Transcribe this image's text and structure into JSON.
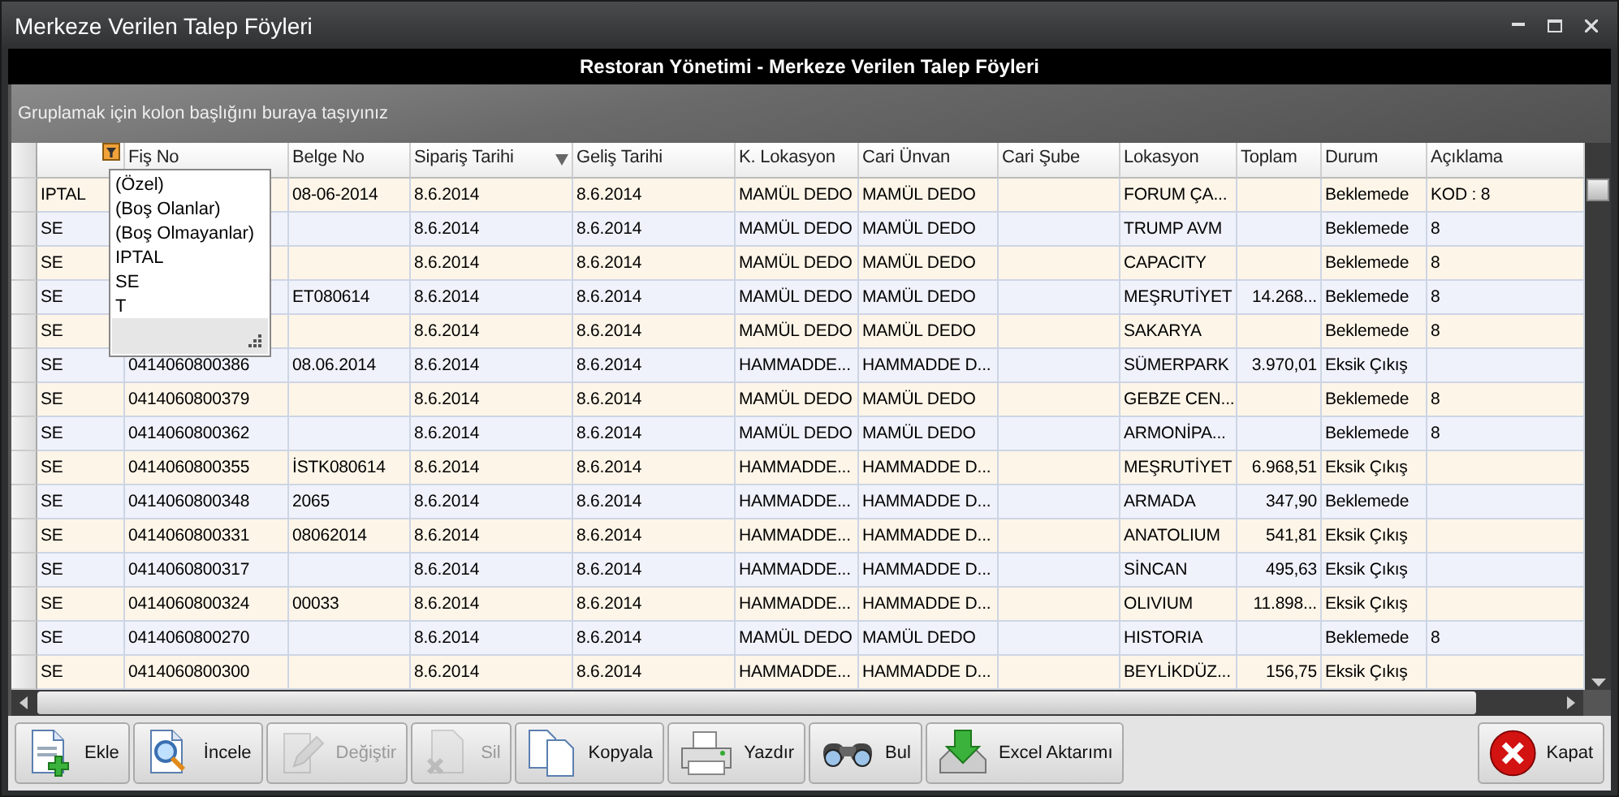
{
  "window": {
    "title": "Merkeze Verilen Talep Föyleri"
  },
  "header": {
    "title": "Restoran Yönetimi - Merkeze Verilen Talep Föyleri"
  },
  "group_panel": {
    "hint": "Gruplamak için kolon başlığını buraya taşıyınız"
  },
  "table": {
    "columns": [
      {
        "filter": true
      },
      {
        "label": "Fiş No"
      },
      {
        "label": "Belge No"
      },
      {
        "label": "Sipariş Tarihi",
        "sorted_descending": true
      },
      {
        "label": "Geliş Tarihi"
      },
      {
        "label": "K. Lokasyon"
      },
      {
        "label": "Cari Ünvan"
      },
      {
        "label": "Cari Şube"
      },
      {
        "label": "Lokasyon"
      },
      {
        "label": "Toplam"
      },
      {
        "label": "Durum"
      },
      {
        "label": "Açıklama"
      }
    ],
    "rows": [
      [
        "IPTAL",
        null,
        "08-06-2014",
        "8.6.2014",
        "8.6.2014",
        "MAMÜL DEDO",
        "MAMÜL DEDO",
        null,
        "FORUM ÇA...",
        null,
        "Beklemede",
        "KOD : 8"
      ],
      [
        "SE",
        null,
        null,
        "8.6.2014",
        "8.6.2014",
        "MAMÜL DEDO",
        "MAMÜL DEDO",
        null,
        "TRUMP AVM",
        null,
        "Beklemede",
        "8"
      ],
      [
        "SE",
        null,
        null,
        "8.6.2014",
        "8.6.2014",
        "MAMÜL DEDO",
        "MAMÜL DEDO",
        null,
        "CAPACITY",
        null,
        "Beklemede",
        "8"
      ],
      [
        "SE",
        null,
        "ET080614",
        "8.6.2014",
        "8.6.2014",
        "MAMÜL DEDO",
        "MAMÜL DEDO",
        null,
        "MEŞRUTİYET",
        "14.268...",
        "Beklemede",
        "8"
      ],
      [
        "SE",
        null,
        null,
        "8.6.2014",
        "8.6.2014",
        "MAMÜL DEDO",
        "MAMÜL DEDO",
        null,
        "SAKARYA",
        null,
        "Beklemede",
        "8"
      ],
      [
        "SE",
        "0414060800386",
        "08.06.2014",
        "8.6.2014",
        "8.6.2014",
        "HAMMADDE...",
        "HAMMADDE D...",
        null,
        "SÜMERPARK",
        "3.970,01",
        "Eksik Çıkış",
        null
      ],
      [
        "SE",
        "0414060800379",
        null,
        "8.6.2014",
        "8.6.2014",
        "MAMÜL DEDO",
        "MAMÜL DEDO",
        null,
        "GEBZE CEN...",
        null,
        "Beklemede",
        "8"
      ],
      [
        "SE",
        "0414060800362",
        null,
        "8.6.2014",
        "8.6.2014",
        "MAMÜL DEDO",
        "MAMÜL DEDO",
        null,
        "ARMONİPA...",
        null,
        "Beklemede",
        "8"
      ],
      [
        "SE",
        "0414060800355",
        "İSTK080614",
        "8.6.2014",
        "8.6.2014",
        "HAMMADDE...",
        "HAMMADDE D...",
        null,
        "MEŞRUTİYET",
        "6.968,51",
        "Eksik Çıkış",
        null
      ],
      [
        "SE",
        "0414060800348",
        "2065",
        "8.6.2014",
        "8.6.2014",
        "HAMMADDE...",
        "HAMMADDE D...",
        null,
        "ARMADA",
        "347,90",
        "Beklemede",
        null
      ],
      [
        "SE",
        "0414060800331",
        "08062014",
        "8.6.2014",
        "8.6.2014",
        "HAMMADDE...",
        "HAMMADDE D...",
        null,
        "ANATOLIUM",
        "541,81",
        "Eksik Çıkış",
        null
      ],
      [
        "SE",
        "0414060800317",
        null,
        "8.6.2014",
        "8.6.2014",
        "HAMMADDE...",
        "HAMMADDE D...",
        null,
        "SİNCAN",
        "495,63",
        "Eksik Çıkış",
        null
      ],
      [
        "SE",
        "0414060800324",
        "00033",
        "8.6.2014",
        "8.6.2014",
        "HAMMADDE...",
        "HAMMADDE D...",
        null,
        "OLIVIUM",
        "11.898...",
        "Eksik Çıkış",
        null
      ],
      [
        "SE",
        "0414060800270",
        null,
        "8.6.2014",
        "8.6.2014",
        "MAMÜL DEDO",
        "MAMÜL DEDO",
        null,
        "HISTORIA",
        null,
        "Beklemede",
        "8"
      ],
      [
        "SE",
        "0414060800300",
        null,
        "8.6.2014",
        "8.6.2014",
        "HAMMADDE...",
        "HAMMADDE D...",
        null,
        "BEYLİKDÜZ...",
        "156,75",
        "Eksik Çıkış",
        null
      ]
    ]
  },
  "filter_popup": {
    "items": [
      "(Özel)",
      "(Boş Olanlar)",
      "(Boş Olmayanlar)",
      "IPTAL",
      "SE",
      "T"
    ]
  },
  "toolbar": {
    "buttons": [
      {
        "label": "Ekle",
        "kind": "add",
        "disabled": false
      },
      {
        "label": "İncele",
        "kind": "view",
        "disabled": false
      },
      {
        "label": "Değiştir",
        "kind": "edit",
        "disabled": true
      },
      {
        "label": "Sil",
        "kind": "delete",
        "disabled": true
      },
      {
        "label": "Kopyala",
        "kind": "copy",
        "disabled": false
      },
      {
        "label": "Yazdır",
        "kind": "print",
        "disabled": false
      },
      {
        "label": "Bul",
        "kind": "find",
        "disabled": false
      },
      {
        "label": "Excel Aktarımı",
        "kind": "export",
        "disabled": false
      }
    ],
    "close_button": {
      "label": "Kapat",
      "kind": "close",
      "disabled": false
    }
  }
}
